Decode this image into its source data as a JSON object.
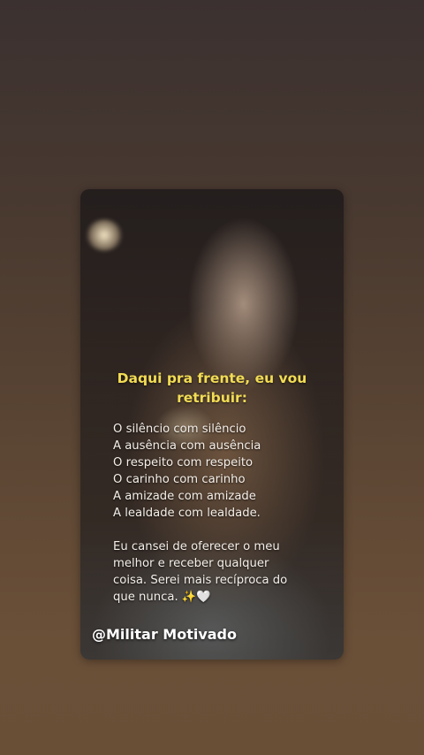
{
  "post": {
    "title_line1": "Daqui pra frente, eu vou",
    "title_line2": "retribuir:",
    "lines": [
      "O silêncio com silêncio",
      "A ausência com ausência",
      "O respeito com respeito",
      "O carinho com carinho",
      "A amizade com amizade",
      "A lealdade com lealdade."
    ],
    "paragraph": [
      "Eu cansei de oferecer o meu",
      "melhor e receber qualquer",
      "coisa. Serei mais recíproca do",
      "que nunca. ✨🤍"
    ],
    "watermark": "@Militar Motivado"
  },
  "colors": {
    "title": "#f2dc54",
    "body_text": "#f4efe9"
  }
}
